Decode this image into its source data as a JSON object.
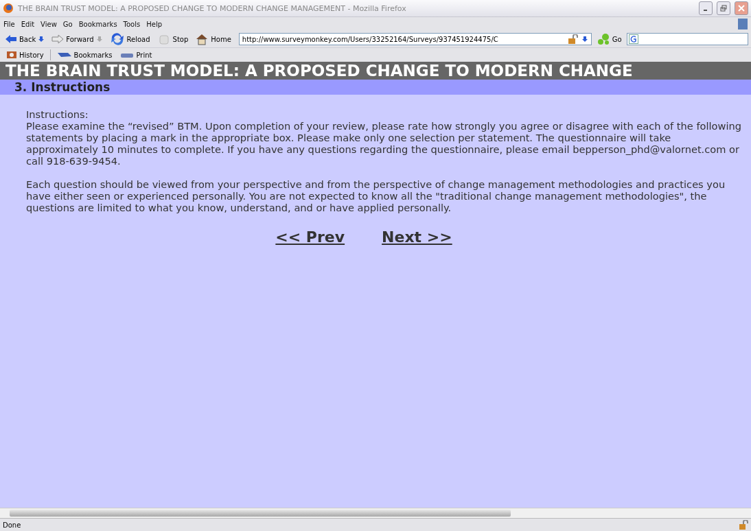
{
  "window": {
    "title": "THE BRAIN TRUST MODEL: A PROPOSED CHANGE TO MODERN CHANGE MANAGEMENT - Mozilla Firefox"
  },
  "menu": [
    "File",
    "Edit",
    "View",
    "Go",
    "Bookmarks",
    "Tools",
    "Help"
  ],
  "nav_buttons": [
    {
      "kind": "back",
      "label": "Back"
    },
    {
      "kind": "forward",
      "label": "Forward"
    },
    {
      "kind": "reload",
      "label": "Reload"
    },
    {
      "kind": "stop",
      "label": "Stop"
    },
    {
      "kind": "home",
      "label": "Home"
    }
  ],
  "address": {
    "value": "http://www.surveymonkey.com/Users/33252164/Surveys/937451924475/C"
  },
  "go_label": "Go",
  "bookmarks_bar": [
    {
      "kind": "history",
      "label": "History"
    },
    {
      "kind": "bookmarks",
      "label": "Bookmarks"
    },
    {
      "kind": "print",
      "label": "Print"
    }
  ],
  "page": {
    "banner": "THE BRAIN TRUST MODEL: A PROPOSED CHANGE TO MODERN CHANGE",
    "section": "3. Instructions",
    "paragraphs": [
      "Instructions:\nPlease examine the “revised” BTM. Upon completion of your review, please rate how strongly you agree or disagree with each of the following statements by placing a mark in the appropriate box. Please make only one selection per statement. The questionnaire will take approximately 10 minutes to complete. If you have any questions regarding the questionnaire, please email bepperson_phd@valornet.com or call 918-639-9454.",
      "Each question should be viewed from your perspective and from the perspective of change management methodologies and practices you have either seen or experienced personally. You are not expected to know all the \"traditional change management methodologies\", the questions are limited to what you know, understand, and or have applied personally."
    ],
    "links": [
      "<< Prev",
      "Next >>"
    ]
  },
  "status_bar": {
    "text": "Done"
  }
}
